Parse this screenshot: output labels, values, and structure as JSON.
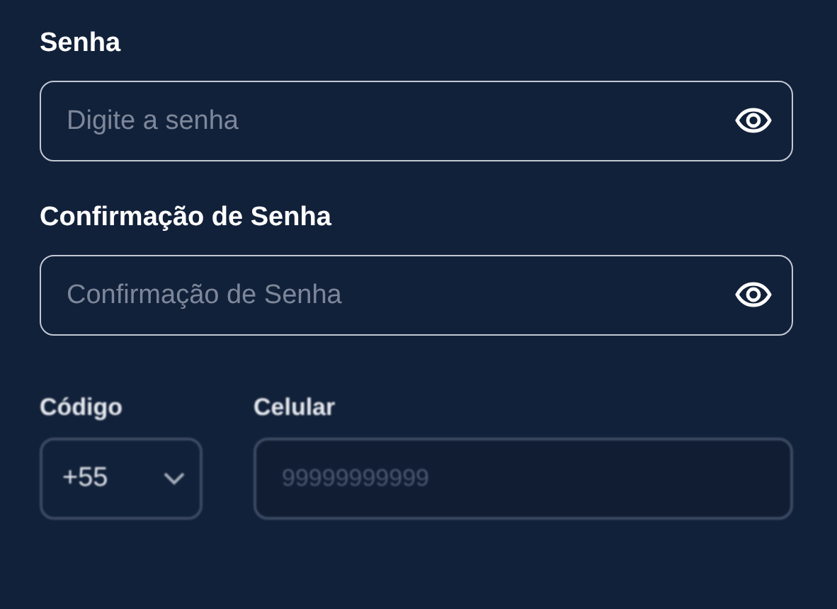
{
  "password": {
    "label": "Senha",
    "placeholder": "Digite a senha"
  },
  "password_confirmation": {
    "label": "Confirmação de Senha",
    "placeholder": "Confirmação de Senha"
  },
  "phone": {
    "code": {
      "label": "Código",
      "value": "+55"
    },
    "number": {
      "label": "Celular",
      "placeholder": "99999999999"
    }
  }
}
